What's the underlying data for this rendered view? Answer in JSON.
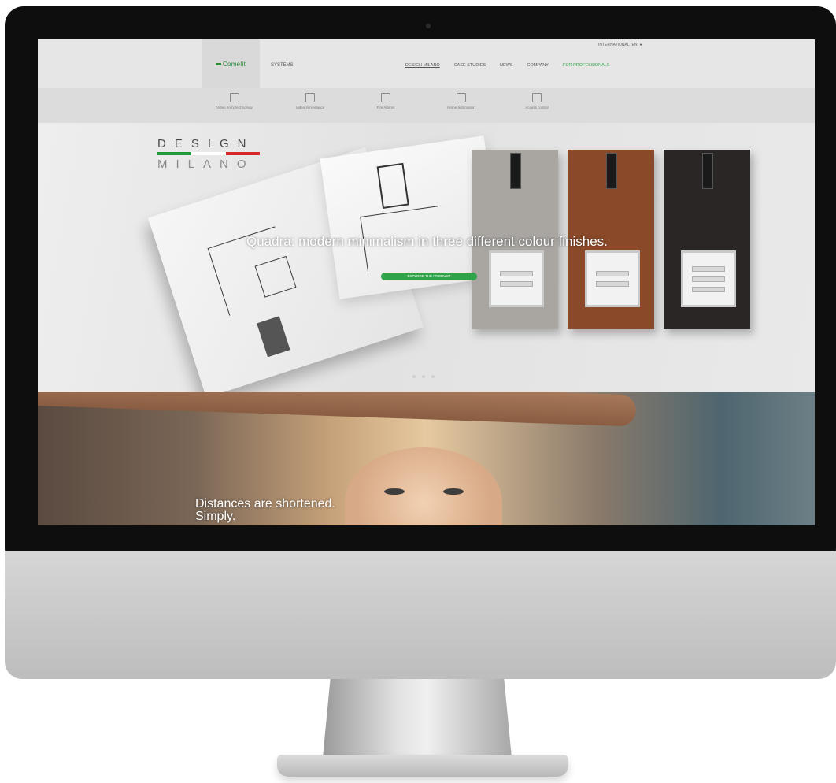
{
  "header": {
    "logo_text": "Comelit",
    "systems_label": "SYSTEMS",
    "language": "INTERNATIONAL (EN)",
    "nav": [
      {
        "label": "DESIGN MILANO",
        "state": "active"
      },
      {
        "label": "CASE STUDIES"
      },
      {
        "label": "NEWS"
      },
      {
        "label": "COMPANY"
      },
      {
        "label": "FOR PROFESSIONALS",
        "state": "highlight"
      }
    ]
  },
  "subnav": [
    {
      "label": "Video entry technology",
      "icon": "video-intercom-icon"
    },
    {
      "label": "Video surveillance",
      "icon": "camera-icon"
    },
    {
      "label": "Fire Alarms",
      "icon": "fire-alarm-icon"
    },
    {
      "label": "Home automation",
      "icon": "home-automation-icon"
    },
    {
      "label": "Access control",
      "icon": "access-control-icon"
    }
  ],
  "hero": {
    "design_word": "DESIGN",
    "milano_word": "MILANO",
    "headline": "Quadra: modern minimalism in three different colour finishes.",
    "cta_label": "EXPLORE THE PRODUCT",
    "colors": {
      "flag_green": "#1f9a3b",
      "flag_white": "#ffffff",
      "flag_red": "#d42a2a",
      "cta": "#2fa34a"
    },
    "panels": [
      {
        "finish": "steel",
        "color": "#a9a6a2"
      },
      {
        "finish": "copper",
        "color": "#8a4a2a"
      },
      {
        "finish": "black",
        "color": "#2b2626"
      }
    ],
    "slide_count": 3
  },
  "band2": {
    "line1": "Distances are shortened.",
    "line2": "Simply."
  }
}
